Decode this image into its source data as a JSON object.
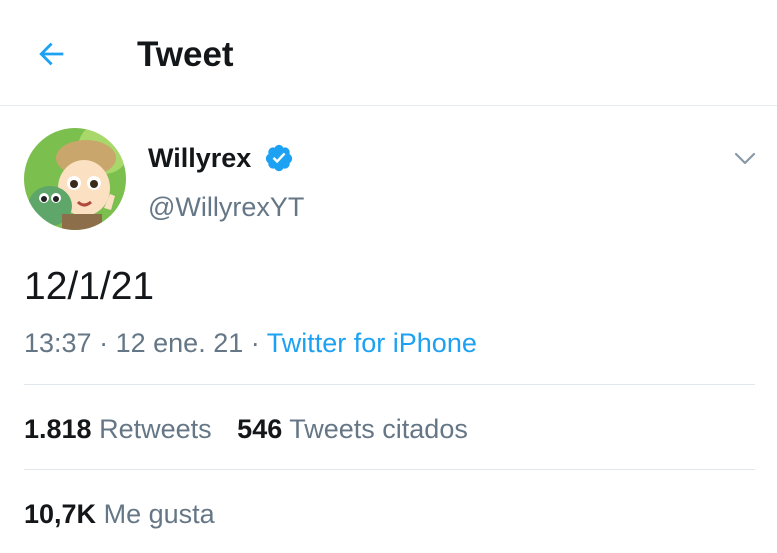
{
  "header": {
    "back_icon": "arrow-left-icon",
    "title": "Tweet"
  },
  "author": {
    "avatar_icon": "avatar-cartoon",
    "display_name": "Willyrex",
    "verified_icon": "verified-badge-icon",
    "handle": "@WillyrexYT"
  },
  "menu_icon": "chevron-down-icon",
  "tweet": {
    "text": "12/1/21",
    "time": "13:37",
    "separator": "·",
    "date": "12 ene. 21",
    "source": "Twitter for iPhone"
  },
  "stats": {
    "retweets_count": "1.818",
    "retweets_label": "Retweets",
    "quotes_count": "546",
    "quotes_label": "Tweets citados",
    "likes_count": "10,7K",
    "likes_label": "Me gusta"
  },
  "colors": {
    "accent": "#1da1f2",
    "secondary_text": "#657786",
    "primary_text": "#14171a"
  }
}
